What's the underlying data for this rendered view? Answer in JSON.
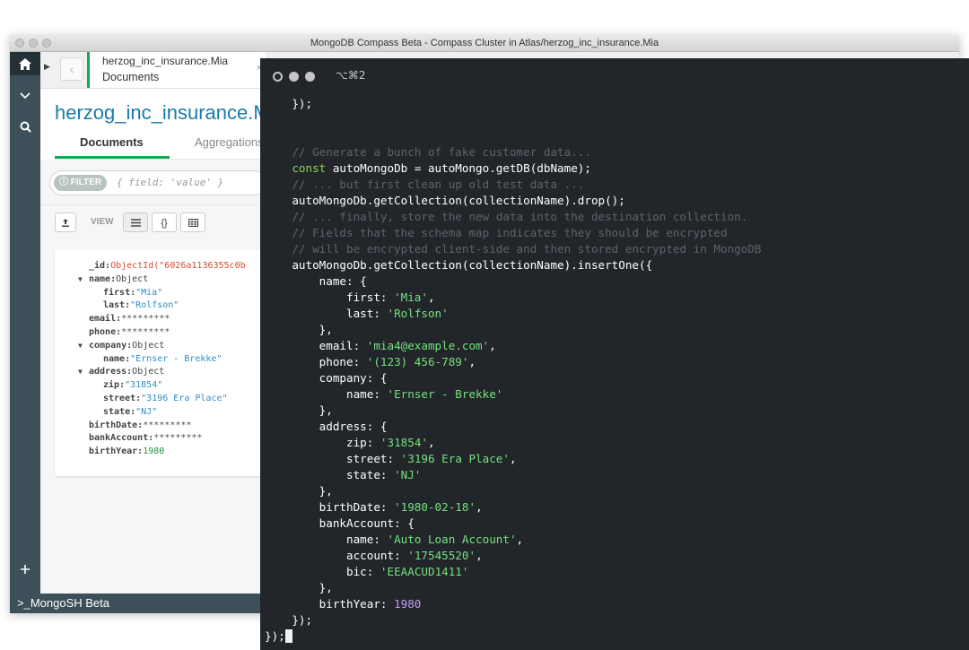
{
  "compass": {
    "window_title": "MongoDB Compass Beta - Compass Cluster in Atlas/herzog_inc_insurance.Mia",
    "tab": {
      "namespace": "herzog_inc_insurance.Mia",
      "subtitle": "Documents",
      "close": "×"
    },
    "namespace_title": "herzog_inc_insurance.Mia",
    "subtabs": [
      "Documents",
      "Aggregations"
    ],
    "filter": {
      "pill": "FILTER",
      "placeholder": "{ field: 'value' }"
    },
    "toolbar": {
      "view_label": "VIEW",
      "export_icon": "export-icon",
      "list_icon": "list-icon",
      "json_icon": "{}",
      "table_icon": "table-icon"
    },
    "document": [
      {
        "key": "_id",
        "value": "ObjectId(\"6026a1136355c0b",
        "kind": "id",
        "indent": 0,
        "toggle": false
      },
      {
        "key": "name",
        "value": "Object",
        "kind": "obj",
        "indent": 0,
        "toggle": true
      },
      {
        "key": "first",
        "value": "\"Mia\"",
        "kind": "str",
        "indent": 1,
        "toggle": false
      },
      {
        "key": "last",
        "value": "\"Rolfson\"",
        "kind": "str",
        "indent": 1,
        "toggle": false
      },
      {
        "key": "email",
        "value": "*********",
        "kind": "mask",
        "indent": 0,
        "toggle": false
      },
      {
        "key": "phone",
        "value": "*********",
        "kind": "mask",
        "indent": 0,
        "toggle": false
      },
      {
        "key": "company",
        "value": "Object",
        "kind": "obj",
        "indent": 0,
        "toggle": true
      },
      {
        "key": "name",
        "value": "\"Ernser - Brekke\"",
        "kind": "str",
        "indent": 1,
        "toggle": false
      },
      {
        "key": "address",
        "value": "Object",
        "kind": "obj",
        "indent": 0,
        "toggle": true
      },
      {
        "key": "zip",
        "value": "\"31854\"",
        "kind": "str",
        "indent": 1,
        "toggle": false
      },
      {
        "key": "street",
        "value": "\"3196 Era Place\"",
        "kind": "str",
        "indent": 1,
        "toggle": false
      },
      {
        "key": "state",
        "value": "\"NJ\"",
        "kind": "str",
        "indent": 1,
        "toggle": false
      },
      {
        "key": "birthDate",
        "value": "*********",
        "kind": "mask",
        "indent": 0,
        "toggle": false
      },
      {
        "key": "bankAccount",
        "value": "*********",
        "kind": "mask",
        "indent": 0,
        "toggle": false
      },
      {
        "key": "birthYear",
        "value": "1980",
        "kind": "num",
        "indent": 0,
        "toggle": false
      }
    ],
    "shell_label": ">_MongoSH Beta"
  },
  "terminal": {
    "title": "⌥⌘2",
    "lines": [
      [
        [
          "t",
          "    });"
        ]
      ],
      [
        [
          "t",
          ""
        ]
      ],
      [
        [
          "t",
          ""
        ]
      ],
      [
        [
          "c",
          "    // Generate a bunch of fake customer data..."
        ]
      ],
      [
        [
          "kw",
          "    const "
        ],
        [
          "t",
          "autoMongoDb = autoMongo.getDB(dbName);"
        ]
      ],
      [
        [
          "c",
          "    // ... but first clean up old test data ..."
        ]
      ],
      [
        [
          "t",
          "    autoMongoDb.getCollection(collectionName).drop();"
        ]
      ],
      [
        [
          "c",
          "    // ... finally, store the new data into the destination collection."
        ]
      ],
      [
        [
          "c",
          "    // Fields that the schema map indicates they should be encrypted"
        ]
      ],
      [
        [
          "c",
          "    // will be encrypted client-side and then stored encrypted in MongoDB"
        ]
      ],
      [
        [
          "t",
          "    autoMongoDb.getCollection(collectionName).insertOne({"
        ]
      ],
      [
        [
          "t",
          "        name: {"
        ]
      ],
      [
        [
          "t",
          "            first: "
        ],
        [
          "s",
          "'Mia'"
        ],
        [
          "t",
          ","
        ]
      ],
      [
        [
          "t",
          "            last: "
        ],
        [
          "s",
          "'Rolfson'"
        ]
      ],
      [
        [
          "t",
          "        },"
        ]
      ],
      [
        [
          "t",
          "        email: "
        ],
        [
          "s",
          "'mia4@example.com'"
        ],
        [
          "t",
          ","
        ]
      ],
      [
        [
          "t",
          "        phone: "
        ],
        [
          "s",
          "'(123) 456-789'"
        ],
        [
          "t",
          ","
        ]
      ],
      [
        [
          "t",
          "        company: {"
        ]
      ],
      [
        [
          "t",
          "            name: "
        ],
        [
          "s",
          "'Ernser - Brekke'"
        ]
      ],
      [
        [
          "t",
          "        },"
        ]
      ],
      [
        [
          "t",
          "        address: {"
        ]
      ],
      [
        [
          "t",
          "            zip: "
        ],
        [
          "s",
          "'31854'"
        ],
        [
          "t",
          ","
        ]
      ],
      [
        [
          "t",
          "            street: "
        ],
        [
          "s",
          "'3196 Era Place'"
        ],
        [
          "t",
          ","
        ]
      ],
      [
        [
          "t",
          "            state: "
        ],
        [
          "s",
          "'NJ'"
        ]
      ],
      [
        [
          "t",
          "        },"
        ]
      ],
      [
        [
          "t",
          "        birthDate: "
        ],
        [
          "s",
          "'1980-02-18'"
        ],
        [
          "t",
          ","
        ]
      ],
      [
        [
          "t",
          "        bankAccount: {"
        ]
      ],
      [
        [
          "t",
          "            name: "
        ],
        [
          "s",
          "'Auto Loan Account'"
        ],
        [
          "t",
          ","
        ]
      ],
      [
        [
          "t",
          "            account: "
        ],
        [
          "s",
          "'17545520'"
        ],
        [
          "t",
          ","
        ]
      ],
      [
        [
          "t",
          "            bic: "
        ],
        [
          "s",
          "'EEAACUD1411'"
        ]
      ],
      [
        [
          "t",
          "        },"
        ]
      ],
      [
        [
          "t",
          "        birthYear: "
        ],
        [
          "n",
          "1980"
        ]
      ],
      [
        [
          "t",
          "    });"
        ]
      ],
      [
        [
          "t",
          "});"
        ]
      ]
    ]
  }
}
